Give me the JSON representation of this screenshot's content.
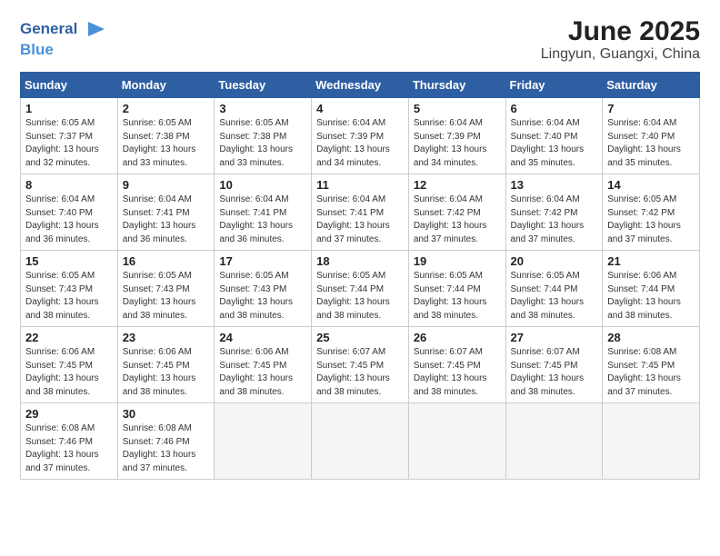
{
  "header": {
    "logo_general": "General",
    "logo_blue": "Blue",
    "title": "June 2025",
    "subtitle": "Lingyun, Guangxi, China"
  },
  "calendar": {
    "days_of_week": [
      "Sunday",
      "Monday",
      "Tuesday",
      "Wednesday",
      "Thursday",
      "Friday",
      "Saturday"
    ],
    "weeks": [
      [
        {
          "day": "1",
          "sunrise": "6:05 AM",
          "sunset": "7:37 PM",
          "daylight": "13 hours and 32 minutes."
        },
        {
          "day": "2",
          "sunrise": "6:05 AM",
          "sunset": "7:38 PM",
          "daylight": "13 hours and 33 minutes."
        },
        {
          "day": "3",
          "sunrise": "6:05 AM",
          "sunset": "7:38 PM",
          "daylight": "13 hours and 33 minutes."
        },
        {
          "day": "4",
          "sunrise": "6:04 AM",
          "sunset": "7:39 PM",
          "daylight": "13 hours and 34 minutes."
        },
        {
          "day": "5",
          "sunrise": "6:04 AM",
          "sunset": "7:39 PM",
          "daylight": "13 hours and 34 minutes."
        },
        {
          "day": "6",
          "sunrise": "6:04 AM",
          "sunset": "7:40 PM",
          "daylight": "13 hours and 35 minutes."
        },
        {
          "day": "7",
          "sunrise": "6:04 AM",
          "sunset": "7:40 PM",
          "daylight": "13 hours and 35 minutes."
        }
      ],
      [
        {
          "day": "8",
          "sunrise": "6:04 AM",
          "sunset": "7:40 PM",
          "daylight": "13 hours and 36 minutes."
        },
        {
          "day": "9",
          "sunrise": "6:04 AM",
          "sunset": "7:41 PM",
          "daylight": "13 hours and 36 minutes."
        },
        {
          "day": "10",
          "sunrise": "6:04 AM",
          "sunset": "7:41 PM",
          "daylight": "13 hours and 36 minutes."
        },
        {
          "day": "11",
          "sunrise": "6:04 AM",
          "sunset": "7:41 PM",
          "daylight": "13 hours and 37 minutes."
        },
        {
          "day": "12",
          "sunrise": "6:04 AM",
          "sunset": "7:42 PM",
          "daylight": "13 hours and 37 minutes."
        },
        {
          "day": "13",
          "sunrise": "6:04 AM",
          "sunset": "7:42 PM",
          "daylight": "13 hours and 37 minutes."
        },
        {
          "day": "14",
          "sunrise": "6:05 AM",
          "sunset": "7:42 PM",
          "daylight": "13 hours and 37 minutes."
        }
      ],
      [
        {
          "day": "15",
          "sunrise": "6:05 AM",
          "sunset": "7:43 PM",
          "daylight": "13 hours and 38 minutes."
        },
        {
          "day": "16",
          "sunrise": "6:05 AM",
          "sunset": "7:43 PM",
          "daylight": "13 hours and 38 minutes."
        },
        {
          "day": "17",
          "sunrise": "6:05 AM",
          "sunset": "7:43 PM",
          "daylight": "13 hours and 38 minutes."
        },
        {
          "day": "18",
          "sunrise": "6:05 AM",
          "sunset": "7:44 PM",
          "daylight": "13 hours and 38 minutes."
        },
        {
          "day": "19",
          "sunrise": "6:05 AM",
          "sunset": "7:44 PM",
          "daylight": "13 hours and 38 minutes."
        },
        {
          "day": "20",
          "sunrise": "6:05 AM",
          "sunset": "7:44 PM",
          "daylight": "13 hours and 38 minutes."
        },
        {
          "day": "21",
          "sunrise": "6:06 AM",
          "sunset": "7:44 PM",
          "daylight": "13 hours and 38 minutes."
        }
      ],
      [
        {
          "day": "22",
          "sunrise": "6:06 AM",
          "sunset": "7:45 PM",
          "daylight": "13 hours and 38 minutes."
        },
        {
          "day": "23",
          "sunrise": "6:06 AM",
          "sunset": "7:45 PM",
          "daylight": "13 hours and 38 minutes."
        },
        {
          "day": "24",
          "sunrise": "6:06 AM",
          "sunset": "7:45 PM",
          "daylight": "13 hours and 38 minutes."
        },
        {
          "day": "25",
          "sunrise": "6:07 AM",
          "sunset": "7:45 PM",
          "daylight": "13 hours and 38 minutes."
        },
        {
          "day": "26",
          "sunrise": "6:07 AM",
          "sunset": "7:45 PM",
          "daylight": "13 hours and 38 minutes."
        },
        {
          "day": "27",
          "sunrise": "6:07 AM",
          "sunset": "7:45 PM",
          "daylight": "13 hours and 38 minutes."
        },
        {
          "day": "28",
          "sunrise": "6:08 AM",
          "sunset": "7:45 PM",
          "daylight": "13 hours and 37 minutes."
        }
      ],
      [
        {
          "day": "29",
          "sunrise": "6:08 AM",
          "sunset": "7:46 PM",
          "daylight": "13 hours and 37 minutes."
        },
        {
          "day": "30",
          "sunrise": "6:08 AM",
          "sunset": "7:46 PM",
          "daylight": "13 hours and 37 minutes."
        },
        null,
        null,
        null,
        null,
        null
      ]
    ]
  }
}
